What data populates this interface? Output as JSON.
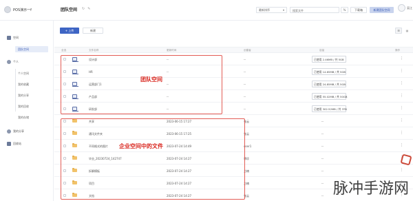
{
  "topbar": {
    "org_name": "POS演示一f",
    "page_title": "团队空间",
    "sort_select": "最新排序",
    "search_placeholder": "搜索文件",
    "pct_label": "%",
    "download_label": "下载箱",
    "new_team_label": "新建团队空间",
    "user_name": "吴江"
  },
  "sidebar": {
    "section_enterprise": "空间",
    "item_team_space": "团队空间",
    "section_personal": "个人",
    "sub_items": [
      "个人空间",
      "我的收藏",
      "我的分享",
      "我的回收",
      "我的存储"
    ],
    "item_shared": "我的分享",
    "item_recycle": "回收站"
  },
  "toolbar": {
    "upload_label": "+ 上传",
    "new_folder_label": "新建"
  },
  "table": {
    "headers": [
      "全选",
      "文件名称",
      "更新时间",
      "创建者",
      "容量",
      "操作"
    ],
    "team_rows": [
      {
        "name": "设计部",
        "time": "--",
        "owner": "--",
        "quota": "已使用 2.46MB / 共 5GB"
      },
      {
        "name": "HR",
        "time": "--",
        "owner": "--",
        "quota": "已使用 14.65MB / 共 5GB"
      },
      {
        "name": "运营部门1",
        "time": "--",
        "owner": "--",
        "quota": "已使用 24.85MB / 共 5GB"
      },
      {
        "name": "产品部",
        "time": "--",
        "owner": "--",
        "quota": "已使用 55.02MB / 共 50GB"
      },
      {
        "name": "研发部",
        "time": "--",
        "owner": "--",
        "quota": "已使用 302.52MB / 共 3TB"
      }
    ],
    "folder_rows": [
      {
        "name": "共享",
        "time": "2023-06-15 17:27",
        "owner": "张云",
        "quota": "--"
      },
      {
        "name": "通讯文件夹",
        "time": "2023-06-15 17:25",
        "owner": "张云",
        "quota": "--"
      },
      {
        "name": "不同格式的图片",
        "time": "2023-07-24 14:49",
        "owner": "user1",
        "quota": "--"
      },
      {
        "name": "毕业_20230724_142747",
        "time": "2023-07-24 14:27",
        "owner": "慕珍",
        "quota": "--"
      },
      {
        "name": "拆解模板",
        "time": "2023-07-24 14:27",
        "owner": "方楠",
        "quota": "--"
      },
      {
        "name": "项目",
        "time": "2023-07-24 14:27",
        "owner": "方楠",
        "quota": "--"
      },
      {
        "name": "文档",
        "time": "2023-07-24 14:27",
        "owner": "张云",
        "quota": "--"
      }
    ]
  },
  "annotations": {
    "team_label": "团队空间",
    "folder_label": "企业空间中的文件"
  },
  "watermark": "脉冲手游网",
  "colors": {
    "primary": "#3e65c4",
    "annotation_red": "#e35c55",
    "folder": "#f1c26a"
  }
}
